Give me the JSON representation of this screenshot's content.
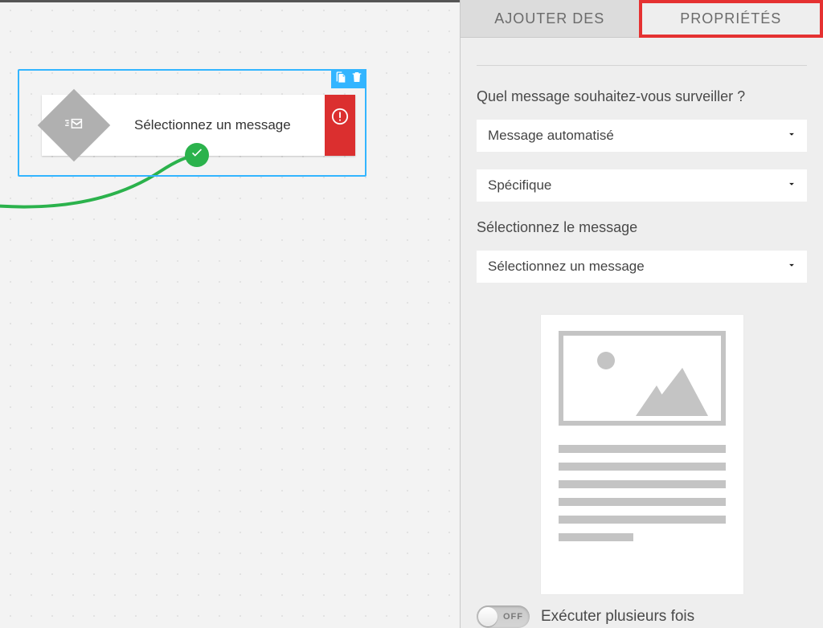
{
  "panel": {
    "tabs": {
      "add": "AJOUTER DES",
      "properties": "PROPRIÉTÉS"
    },
    "q_which_message": "Quel message souhaitez-vous surveiller ?",
    "select_type_value": "Message automatisé",
    "select_scope_value": "Spécifique",
    "q_select_message": "Sélectionnez le message",
    "select_message_value": "Sélectionnez un message",
    "toggle_off": "OFF",
    "toggle_label": "Exécuter plusieurs fois"
  },
  "canvas": {
    "node_label": "Sélectionnez un message"
  }
}
